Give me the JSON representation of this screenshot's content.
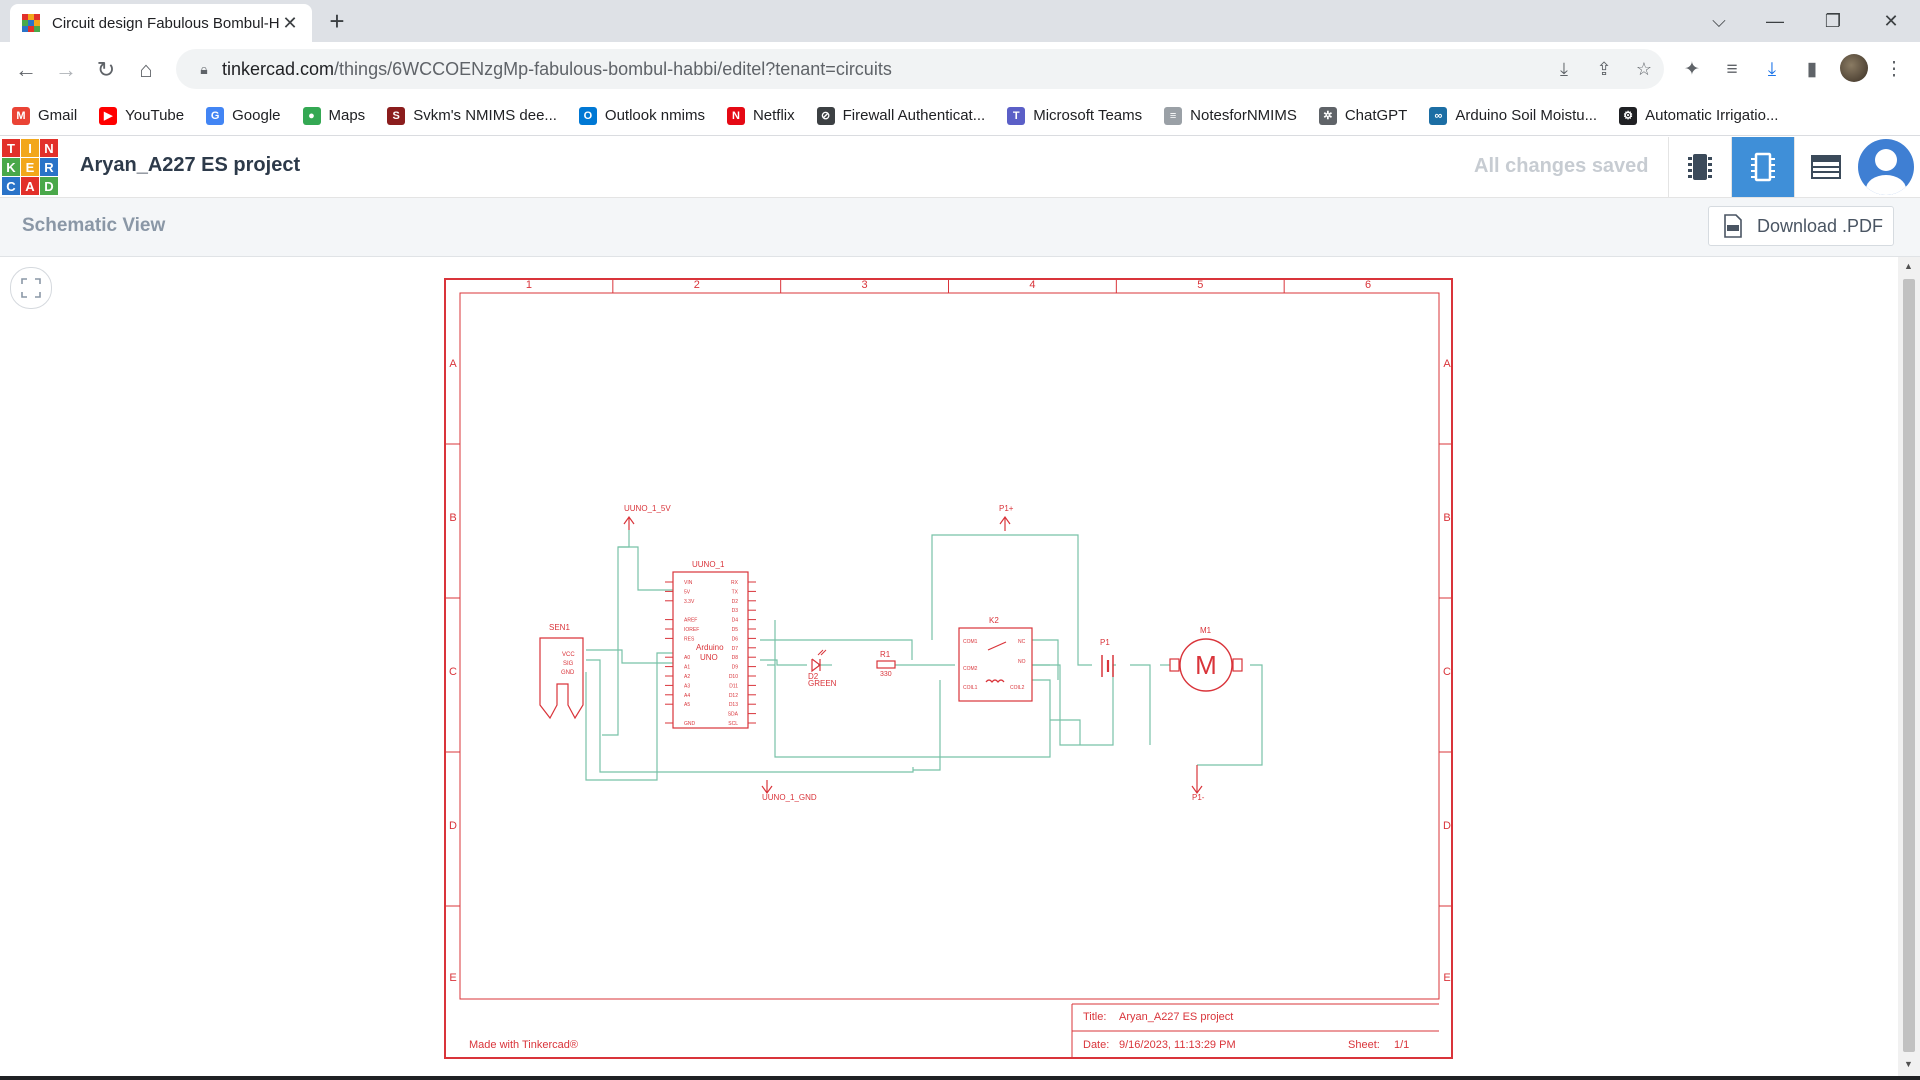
{
  "browser": {
    "tab_title": "Circuit design Fabulous Bombul-H",
    "url_domain": "tinkercad.com",
    "url_path": "/things/6WCCOENzgMp-fabulous-bombul-habbi/editel?tenant=circuits",
    "bookmarks": [
      {
        "label": "Gmail",
        "icon": "gmail-icon",
        "color": "#ea4335"
      },
      {
        "label": "YouTube",
        "icon": "youtube-icon",
        "color": "#ff0000"
      },
      {
        "label": "Google",
        "icon": "google-icon",
        "color": "#4285f4"
      },
      {
        "label": "Maps",
        "icon": "maps-icon",
        "color": "#34a853"
      },
      {
        "label": "Svkm's NMIMS dee...",
        "icon": "nmims-icon",
        "color": "#8b1d1d"
      },
      {
        "label": "Outlook nmims",
        "icon": "outlook-icon",
        "color": "#0078d4"
      },
      {
        "label": "Netflix",
        "icon": "netflix-icon",
        "color": "#e50914"
      },
      {
        "label": "Firewall Authenticat...",
        "icon": "firewall-icon",
        "color": "#3c4043"
      },
      {
        "label": "Microsoft Teams",
        "icon": "teams-icon",
        "color": "#5b5fc7"
      },
      {
        "label": "NotesforNMIMS",
        "icon": "notes-icon",
        "color": "#9aa0a6"
      },
      {
        "label": "ChatGPT",
        "icon": "chatgpt-icon",
        "color": "#5f6368"
      },
      {
        "label": "Arduino Soil Moistu...",
        "icon": "arduino-site-icon",
        "color": "#1c6ea4"
      },
      {
        "label": "Automatic Irrigatio...",
        "icon": "gear-site-icon",
        "color": "#202124"
      }
    ]
  },
  "app": {
    "logo_letters": [
      "T",
      "I",
      "N",
      "K",
      "E",
      "R",
      "C",
      "A",
      "D"
    ],
    "project_name": "Aryan_A227 ES project",
    "save_status": "All changes saved",
    "schematic_title": "Schematic View",
    "download_label": "Download .PDF",
    "accent": "#3f8fd8"
  },
  "schematic": {
    "columns": [
      "1",
      "2",
      "3",
      "4",
      "5",
      "6"
    ],
    "rows": [
      "A",
      "B",
      "C",
      "D",
      "E"
    ],
    "labels": {
      "vcc_net": "UUNO_1_5V",
      "gnd_net": "UUNO_1_GND",
      "p_plus": "P1+",
      "p_minus": "P1-",
      "arduino_ref": "UUNO_1",
      "arduino_name1": "Arduino",
      "arduino_name2": "UNO",
      "sensor_ref": "SEN1",
      "sensor_pin_vcc": "VCC",
      "sensor_pin_sig": "SIG",
      "sensor_pin_gnd": "GND",
      "led_ref": "D2",
      "led_value": "GREEN",
      "res_ref": "R1",
      "res_value": "330",
      "relay_ref": "K2",
      "relay_com1": "COM1",
      "relay_com2": "COM2",
      "relay_nc": "NC",
      "relay_no": "NO",
      "relay_coil1": "COIL1",
      "relay_coil2": "COIL2",
      "battery_ref": "P1",
      "motor_ref": "M1",
      "motor_symbol": "M"
    },
    "arduino_left_pins": [
      "VIN",
      "5V",
      "3.3V",
      "",
      "AREF",
      "IOREF",
      "RES",
      "",
      "A0",
      "A1",
      "A2",
      "A3",
      "A4",
      "A5",
      "",
      "GND"
    ],
    "arduino_right_pins": [
      "RX",
      "TX",
      "D2",
      "D3",
      "D4",
      "D5",
      "D6",
      "D7",
      "D8",
      "D9",
      "D10",
      "D11",
      "D12",
      "D13",
      "SDA",
      "SCL"
    ],
    "title_label": "Title:",
    "title_value": "Aryan_A227 ES project",
    "date_label": "Date:",
    "date_value": "9/16/2023, 11:13:29 PM",
    "sheet_label": "Sheet:",
    "sheet_value": "1/1",
    "made_with": "Made with Tinkercad®"
  }
}
